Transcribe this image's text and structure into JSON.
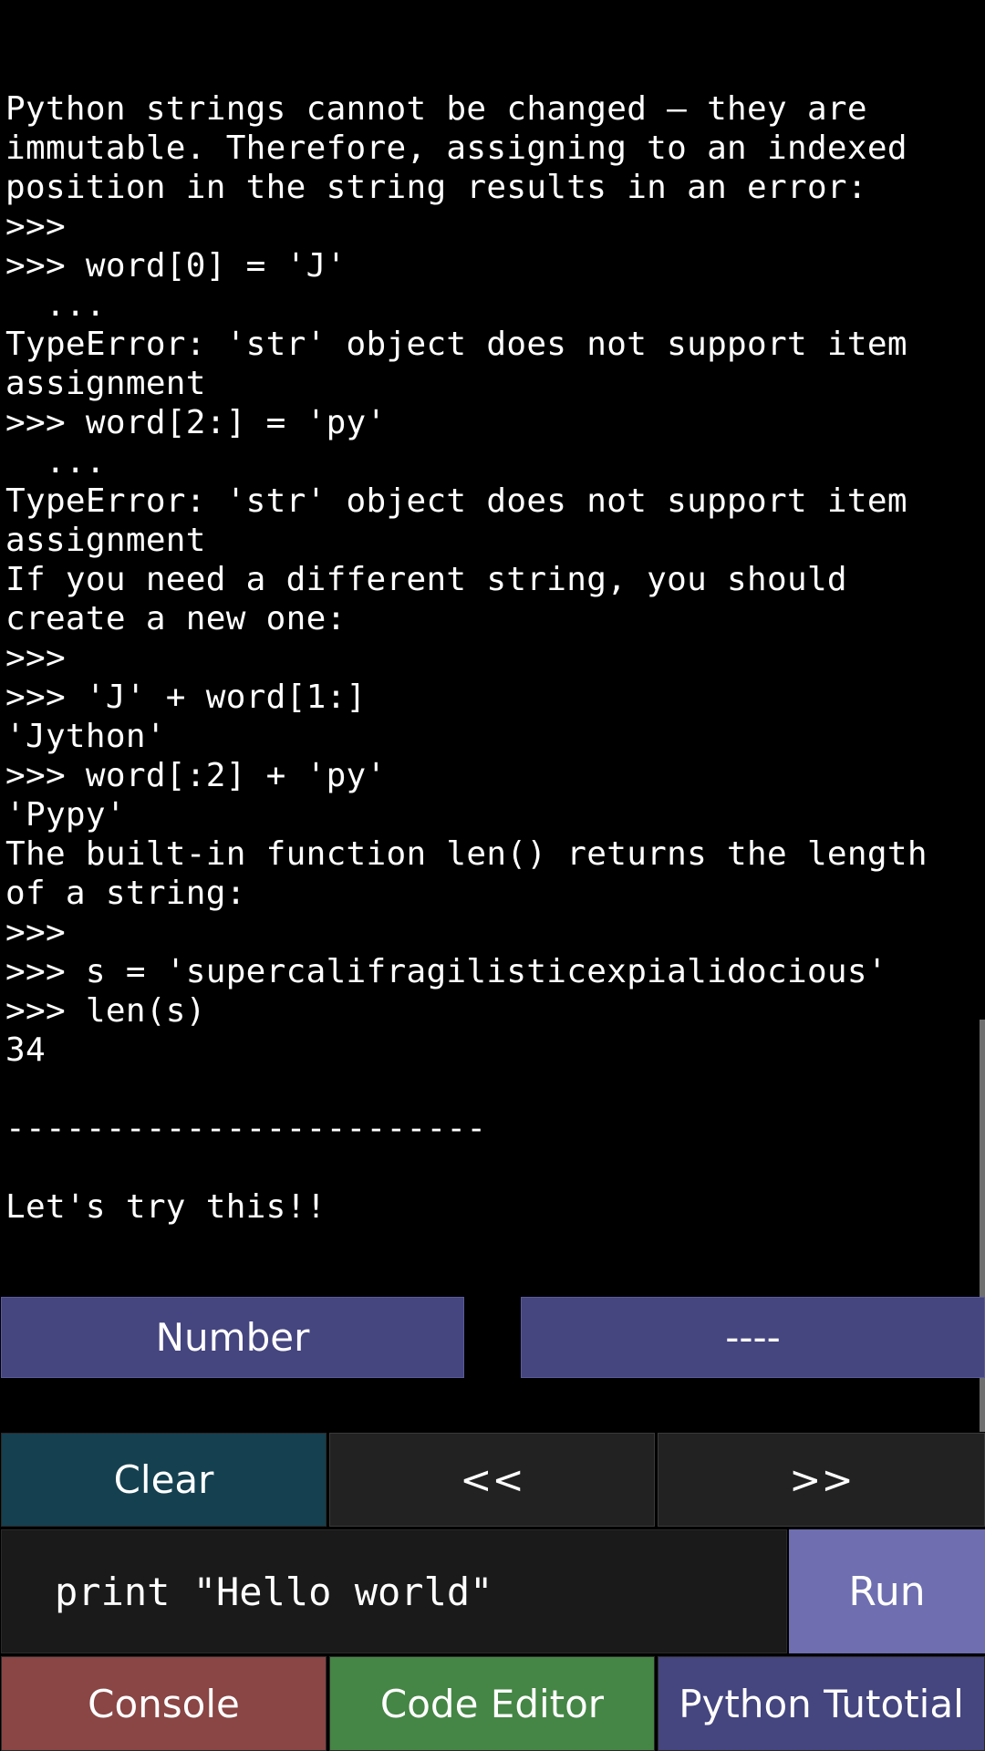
{
  "console": {
    "lines": [
      "Python strings cannot be changed — they are",
      "immutable. Therefore, assigning to an indexed",
      "position in the string results in an error:",
      ">>>",
      ">>> word[0] = 'J'",
      "  ...",
      "TypeError: 'str' object does not support item",
      "assignment",
      ">>> word[2:] = 'py'",
      "  ...",
      "TypeError: 'str' object does not support item",
      "assignment",
      "If you need a different string, you should",
      "create a new one:",
      ">>>",
      ">>> 'J' + word[1:]",
      "'Jython'",
      ">>> word[:2] + 'py'",
      "'Pypy'",
      "The built-in function len() returns the length",
      "of a string:",
      ">>>",
      ">>> s = 'supercalifragilisticexpialidocious'",
      ">>> len(s)",
      "34",
      "",
      "------------------------",
      "",
      "Let's try this!!"
    ]
  },
  "quick_buttons": {
    "number_label": "Number",
    "dashes_label": "----"
  },
  "nav": {
    "clear_label": "Clear",
    "prev_label": "<<",
    "next_label": ">>"
  },
  "input": {
    "value": "print \"Hello world\"",
    "run_label": "Run"
  },
  "tabs": {
    "console_label": "Console",
    "editor_label": "Code Editor",
    "tutorial_label": "Python Tutotial"
  },
  "colors": {
    "accent": "#45457f",
    "clear": "#154050",
    "console_tab": "#8a4545",
    "editor_tab": "#458545",
    "run": "#6e6eb0"
  }
}
